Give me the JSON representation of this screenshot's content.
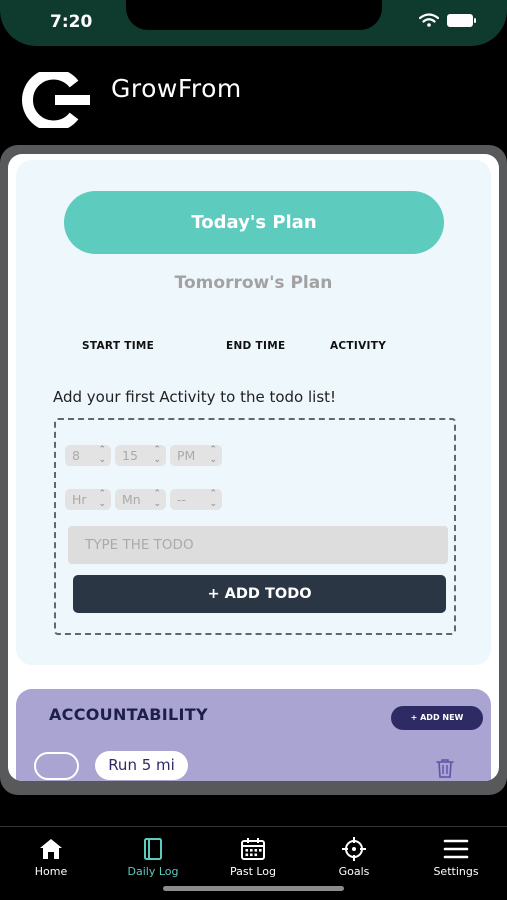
{
  "status_bar": {
    "time": "7:20"
  },
  "header": {
    "title": "GrowFrom"
  },
  "plan": {
    "today_label": "Today's Plan",
    "tomorrow_label": "Tomorrow's Plan",
    "columns": [
      "START TIME",
      "END TIME",
      "ACTIVITY"
    ],
    "empty_message": "Add your first Activity to the todo list!",
    "start": {
      "hour": "8",
      "minute": "15",
      "ampm": "PM"
    },
    "end": {
      "hour": "Hr",
      "minute": "Mn",
      "ampm": "--"
    },
    "todo_placeholder": "TYPE THE TODO",
    "add_button": "+ ADD TODO"
  },
  "accountability": {
    "title": "ACCOUNTABILITY",
    "add_new": "+ ADD NEW",
    "goals": [
      {
        "label": "Run 5 mi",
        "done": false
      }
    ]
  },
  "tabs": [
    {
      "label": "Home",
      "icon": "home-icon",
      "active": false
    },
    {
      "label": "Daily Log",
      "icon": "journal-icon",
      "active": true
    },
    {
      "label": "Past Log",
      "icon": "calendar-icon",
      "active": false
    },
    {
      "label": "Goals",
      "icon": "crosshair-icon",
      "active": false
    },
    {
      "label": "Settings",
      "icon": "menu-icon",
      "active": false
    }
  ],
  "colors": {
    "accent": "#5ecbbf",
    "status_bar": "#0f3b2e",
    "plan_card": "#eef7fc",
    "accountability_card": "#a9a4d2",
    "dark_button": "#2b3645",
    "add_new_button": "#2e2b64"
  }
}
